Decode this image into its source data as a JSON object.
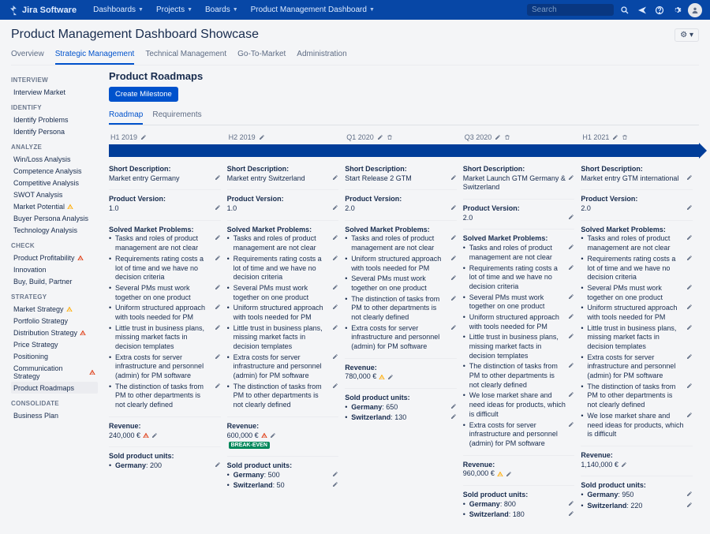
{
  "header": {
    "brand": "Jira Software",
    "items": [
      "Dashboards",
      "Projects",
      "Boards",
      "Product Management Dashboard"
    ],
    "search_placeholder": "Search"
  },
  "page_title": "Product Management Dashboard Showcase",
  "tabs": [
    "Overview",
    "Strategic Management",
    "Technical Management",
    "Go-To-Market",
    "Administration"
  ],
  "sidebar": {
    "groups": [
      {
        "head": "Interview",
        "items": [
          {
            "label": "Interview Market"
          }
        ]
      },
      {
        "head": "Identify",
        "items": [
          {
            "label": "Identify Problems"
          },
          {
            "label": "Identify Persona"
          }
        ]
      },
      {
        "head": "Analyze",
        "items": [
          {
            "label": "Win/Loss Analysis"
          },
          {
            "label": "Competence Analysis"
          },
          {
            "label": "Competitive Analysis"
          },
          {
            "label": "SWOT Analysis"
          },
          {
            "label": "Market Potential",
            "warn": "amber"
          },
          {
            "label": "Buyer Persona Analysis"
          },
          {
            "label": "Technology Analysis"
          }
        ]
      },
      {
        "head": "Check",
        "items": [
          {
            "label": "Product Profitability",
            "warn": "red"
          },
          {
            "label": "Innovation"
          },
          {
            "label": "Buy, Build, Partner"
          }
        ]
      },
      {
        "head": "Strategy",
        "items": [
          {
            "label": "Market Strategy",
            "warn": "amber"
          },
          {
            "label": "Portfolio Strategy"
          },
          {
            "label": "Distribution Strategy",
            "warn": "red"
          },
          {
            "label": "Price Strategy"
          },
          {
            "label": "Positioning"
          },
          {
            "label": "Communication Strategy",
            "warn": "red"
          },
          {
            "label": "Product Roadmaps",
            "active": true
          }
        ]
      },
      {
        "head": "Consolidate",
        "items": [
          {
            "label": "Business Plan"
          }
        ]
      }
    ]
  },
  "roadmap": {
    "title": "Product Roadmaps",
    "create_milestone": "Create Milestone",
    "subtabs": [
      "Roadmap",
      "Requirements"
    ],
    "periods": [
      {
        "name": "H1 2019",
        "trash": false
      },
      {
        "name": "H2 2019",
        "trash": false
      },
      {
        "name": "Q1 2020",
        "trash": true
      },
      {
        "name": "Q3 2020",
        "trash": true
      },
      {
        "name": "H1 2021",
        "trash": true
      }
    ],
    "labels": {
      "short_desc": "Short Description:",
      "product_version": "Product Version:",
      "solved": "Solved Market Problems:",
      "revenue": "Revenue:",
      "sold": "Sold product units:"
    },
    "problems": {
      "p1": "Tasks and roles of product management are not clear",
      "p2": "Requirements rating costs a lot of time and we have no decision criteria",
      "p3": "Several PMs must work together on one product",
      "p4": "Uniform structured approach with tools needed for PM",
      "p5": "Little trust in business plans, missing market facts in decision templates",
      "p6": "Extra costs for server infrastructure and personnel (admin) for PM software",
      "p7": "The distinction of tasks from PM to other departments is not clearly defined",
      "p8": "We lose market share and need ideas for products, which is difficult"
    },
    "columns": [
      {
        "desc": "Market entry Germany",
        "version": "1.0",
        "problem_ids": [
          "p1",
          "p2",
          "p3",
          "p4",
          "p5",
          "p6",
          "p7"
        ],
        "revenue": "240,000 €",
        "rev_warn": "red",
        "rev_badge": null,
        "units": [
          {
            "c": "Germany",
            "v": "200"
          }
        ]
      },
      {
        "desc": "Market entry Switzerland",
        "version": "1.0",
        "problem_ids": [
          "p1",
          "p2",
          "p3",
          "p4",
          "p5",
          "p6",
          "p7"
        ],
        "revenue": "600,000 €",
        "rev_warn": "red",
        "rev_badge": "BREAK-EVEN",
        "units": [
          {
            "c": "Germany",
            "v": "500"
          },
          {
            "c": "Switzerland",
            "v": "50"
          }
        ]
      },
      {
        "desc": "Start Release 2 GTM",
        "version": "2.0",
        "problem_ids": [
          "p1",
          "p4",
          "p3",
          "p7",
          "p6"
        ],
        "revenue": "780,000 €",
        "rev_warn": "amber",
        "rev_badge": null,
        "units": [
          {
            "c": "Germany",
            "v": "650"
          },
          {
            "c": "Switzerland",
            "v": "130"
          }
        ]
      },
      {
        "desc": "Market Launch  GTM Germany & Switzerland",
        "version": "2.0",
        "problem_ids": [
          "p1",
          "p2",
          "p3",
          "p4",
          "p5",
          "p7",
          "p8",
          "p6"
        ],
        "revenue": "960,000 €",
        "rev_warn": "amber",
        "rev_badge": null,
        "units": [
          {
            "c": "Germany",
            "v": "800"
          },
          {
            "c": "Switzerland",
            "v": "180"
          }
        ]
      },
      {
        "desc": "Market entry GTM international",
        "version": "2.0",
        "problem_ids": [
          "p1",
          "p2",
          "p3",
          "p4",
          "p5",
          "p6",
          "p7",
          "p8"
        ],
        "revenue": "1,140,000 €",
        "rev_warn": null,
        "rev_badge": null,
        "units": [
          {
            "c": "Germany",
            "v": "950"
          },
          {
            "c": "Switzerland",
            "v": "220"
          }
        ]
      }
    ]
  }
}
